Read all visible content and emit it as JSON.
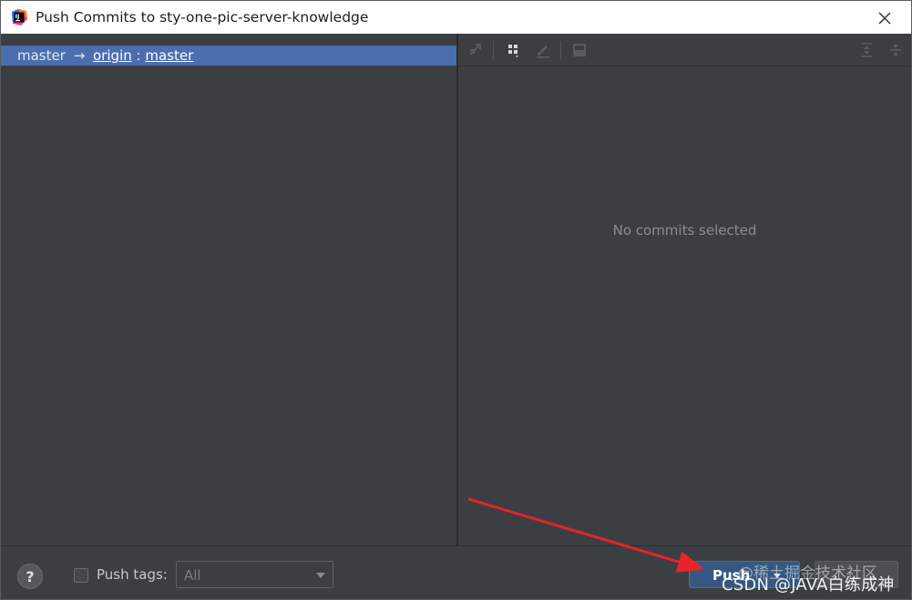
{
  "window": {
    "title": "Push Commits to sty-one-pic-server-knowledge",
    "app_icon": "intellij-idea-icon",
    "close_icon": "close-icon"
  },
  "branch_row": {
    "local_branch": "master",
    "arrow": "→",
    "remote": "origin",
    "separator": ":",
    "remote_branch": "master"
  },
  "toolbar": {
    "icons": [
      "cherry-pick-icon",
      "group-by-icon",
      "edit-icon",
      "save-icon",
      "expand-all-icon",
      "collapse-all-icon"
    ]
  },
  "details": {
    "empty_text": "No commits selected"
  },
  "bottom": {
    "help_label": "?",
    "push_tags_label": "Push tags:",
    "push_tags_checked": false,
    "tags_select_value": "All",
    "push_button_label": "Push",
    "cancel_button_label": ""
  },
  "watermarks": {
    "line1": "@稀土掘金技术社区",
    "line2": "CSDN @JAVA白练成神"
  },
  "colors": {
    "selection": "#4b6eaf",
    "panel_bg": "#3c3f41",
    "push_button": "#365880",
    "annotation_arrow": "#e8232a"
  }
}
